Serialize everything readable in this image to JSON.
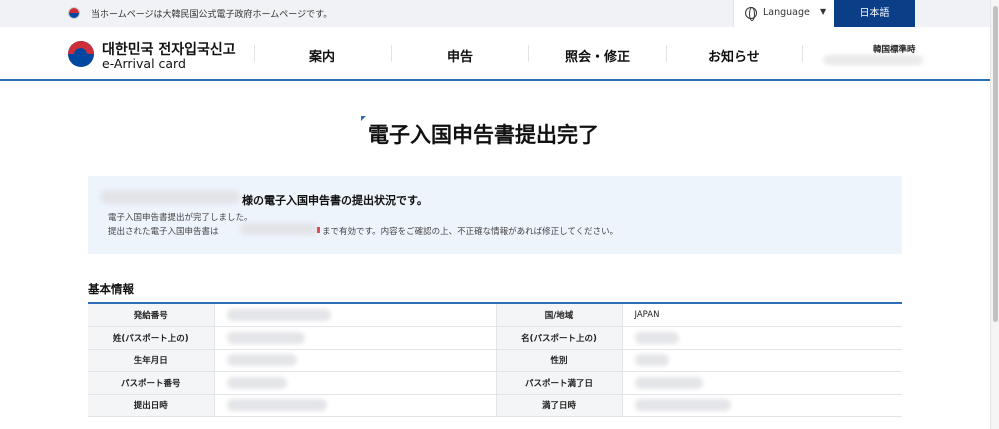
{
  "topbar": {
    "notice": "当ホームページは大韓民国公式電子政府ホームページです。",
    "language_label": "Language",
    "language_button": "日本語"
  },
  "header": {
    "brand_ko": "대한민국 전자입국신고",
    "brand_en": "e-Arrival card",
    "nav": [
      "案内",
      "申告",
      "照会・修正",
      "お知らせ"
    ],
    "time_label": "韓国標準時"
  },
  "page": {
    "title": "電子入国申告書提出完了"
  },
  "status": {
    "headline_suffix": "様の電子入国申告書の提出状況です。",
    "line1": "電子入国申告書提出が完了しました。",
    "line2_prefix": "提出された電子入国申告書は",
    "line2_suffix": "まで有効です。内容をご確認の上、不正確な情報があれば修正してください。"
  },
  "basic_info": {
    "title": "基本情報",
    "rows": [
      {
        "label_left": "発給番号",
        "label_right": "国/地域",
        "value_right": "JAPAN"
      },
      {
        "label_left": "姓(パスポート上の)",
        "label_right": "名(パスポート上の)",
        "value_right": ""
      },
      {
        "label_left": "生年月日",
        "label_right": "性別",
        "value_right": ""
      },
      {
        "label_left": "パスポート番号",
        "label_right": "パスポート満了日",
        "value_right": ""
      },
      {
        "label_left": "提出日時",
        "label_right": "満了日時",
        "value_right": ""
      }
    ]
  },
  "colors": {
    "brand_blue": "#0a3f88",
    "accent_blue": "#2d6db5",
    "status_bg": "#eef4fc"
  }
}
